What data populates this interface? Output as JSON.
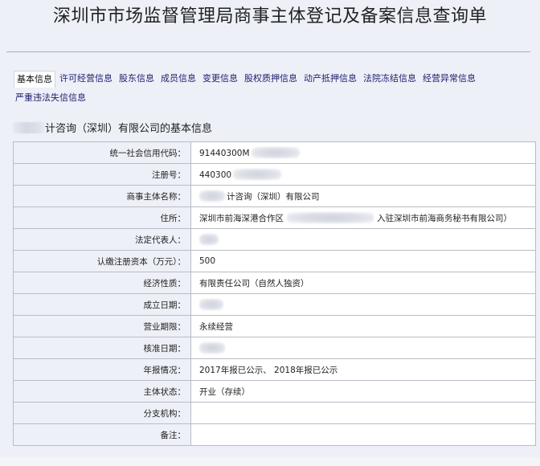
{
  "page": {
    "title": "深圳市市场监督管理局商事主体登记及备案信息查询单"
  },
  "tabs": [
    {
      "label": "基本信息",
      "active": true
    },
    {
      "label": "许可经营信息",
      "active": false
    },
    {
      "label": "股东信息",
      "active": false
    },
    {
      "label": "成员信息",
      "active": false
    },
    {
      "label": "变更信息",
      "active": false
    },
    {
      "label": "股权质押信息",
      "active": false
    },
    {
      "label": "动产抵押信息",
      "active": false
    },
    {
      "label": "法院冻结信息",
      "active": false
    },
    {
      "label": "经营异常信息",
      "active": false
    },
    {
      "label": "严重违法失信信息",
      "active": false
    }
  ],
  "section": {
    "title_suffix": "计咨询（深圳）有限公司的基本信息"
  },
  "rows": [
    {
      "label": "统一社会信用代码：",
      "value": "91440300M"
    },
    {
      "label": "注册号：",
      "value": "440300"
    },
    {
      "label": "商事主体名称：",
      "value": "计咨询（深圳）有限公司"
    },
    {
      "label": "住所：",
      "value": "深圳市前海深港合作区",
      "value_tail": "入驻深圳市前海商务秘书有限公司）"
    },
    {
      "label": "法定代表人：",
      "value": ""
    },
    {
      "label": "认缴注册资本（万元）：",
      "value": "500"
    },
    {
      "label": "经济性质：",
      "value": "有限责任公司（自然人独资）"
    },
    {
      "label": "成立日期：",
      "value": ""
    },
    {
      "label": "营业期限：",
      "value": "永续经营"
    },
    {
      "label": "核准日期：",
      "value": ""
    },
    {
      "label": "年报情况：",
      "value": "2017年报已公示、 2018年报已公示"
    },
    {
      "label": "主体状态：",
      "value": "开业（存续）"
    },
    {
      "label": "分支机构：",
      "value": ""
    },
    {
      "label": "备注：",
      "value": ""
    }
  ]
}
